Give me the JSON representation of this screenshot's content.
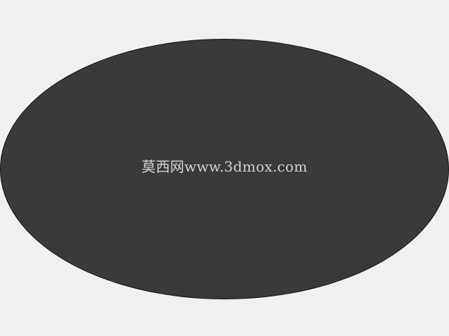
{
  "colors": {
    "background": "#f0f0f0",
    "ellipse_fill": "#3a3a3a",
    "ellipse_stroke": "#111111",
    "watermark_text": "#d2d2d2"
  },
  "watermark": {
    "text": "莫西网www.3dmox.com"
  }
}
